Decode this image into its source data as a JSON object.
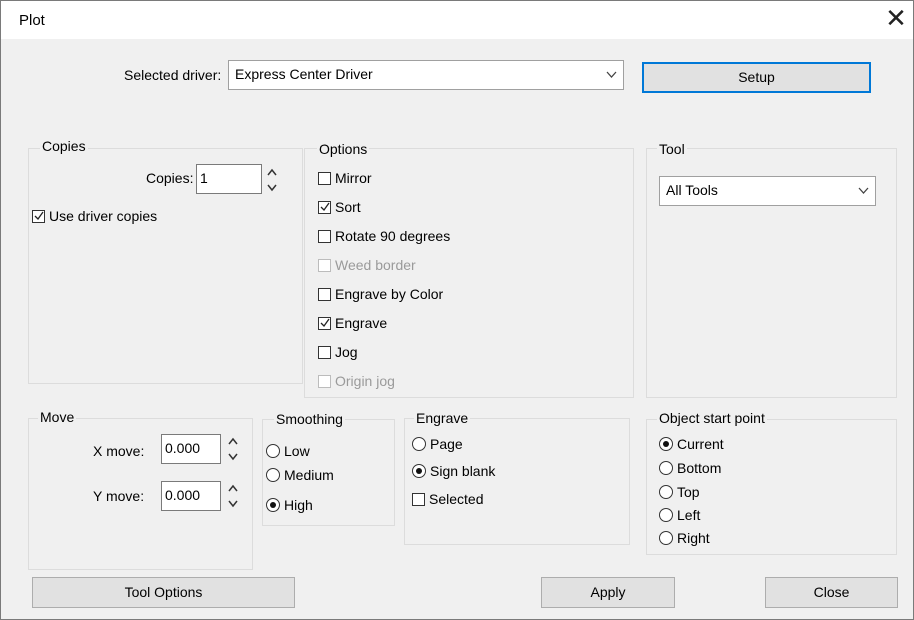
{
  "window": {
    "title": "Plot"
  },
  "driver": {
    "label": "Selected driver:",
    "value": "Express Center Driver",
    "setup_label": "Setup"
  },
  "copies": {
    "group_label": "Copies",
    "copies_label": "Copies:",
    "copies_value": "1",
    "use_driver_copies_label": "Use driver copies",
    "use_driver_copies_checked": true
  },
  "options": {
    "group_label": "Options",
    "items": [
      {
        "label": "Mirror",
        "checked": false,
        "enabled": true
      },
      {
        "label": "Sort",
        "checked": true,
        "enabled": true
      },
      {
        "label": "Rotate 90 degrees",
        "checked": false,
        "enabled": true
      },
      {
        "label": "Weed border",
        "checked": false,
        "enabled": false
      },
      {
        "label": "Engrave by Color",
        "checked": false,
        "enabled": true
      },
      {
        "label": "Engrave",
        "checked": true,
        "enabled": true
      },
      {
        "label": "Jog",
        "checked": false,
        "enabled": true
      },
      {
        "label": "Origin jog",
        "checked": false,
        "enabled": false
      }
    ]
  },
  "tool": {
    "group_label": "Tool",
    "value": "All Tools"
  },
  "move": {
    "group_label": "Move",
    "x_label": "X move:",
    "x_value": "0.000",
    "y_label": "Y move:",
    "y_value": "0.000"
  },
  "smoothing": {
    "group_label": "Smoothing",
    "items": [
      {
        "label": "Low",
        "selected": false
      },
      {
        "label": "Medium",
        "selected": false
      },
      {
        "label": "High",
        "selected": true
      }
    ]
  },
  "engrave": {
    "group_label": "Engrave",
    "page_label": "Page",
    "page_selected": false,
    "sign_blank_label": "Sign blank",
    "sign_blank_selected": true,
    "selected_label": "Selected",
    "selected_checked": false
  },
  "start_point": {
    "group_label": "Object start point",
    "items": [
      {
        "label": "Current",
        "selected": true
      },
      {
        "label": "Bottom",
        "selected": false
      },
      {
        "label": "Top",
        "selected": false
      },
      {
        "label": "Left",
        "selected": false
      },
      {
        "label": "Right",
        "selected": false
      }
    ]
  },
  "footer": {
    "tool_options_label": "Tool Options",
    "apply_label": "Apply",
    "close_label": "Close"
  },
  "colors": {
    "accent": "#0078d7",
    "dialog_bg": "#f0f0f0",
    "disabled_text": "#9a9a9a"
  }
}
